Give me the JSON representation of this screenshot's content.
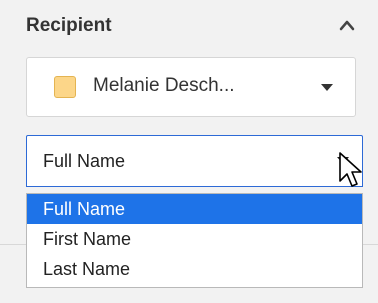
{
  "recipient_section": {
    "title": "Recipient",
    "collapse_icon": "chevron-up-icon",
    "selected_recipient": {
      "name": "Melanie Desch...",
      "swatch_color": "#fcd689"
    }
  },
  "field_dropdown": {
    "value": "Full Name",
    "options": [
      {
        "label": "Full Name",
        "selected": true
      },
      {
        "label": "First Name",
        "selected": false
      },
      {
        "label": "Last Name",
        "selected": false
      }
    ],
    "accent_color": "#1e73e8"
  }
}
